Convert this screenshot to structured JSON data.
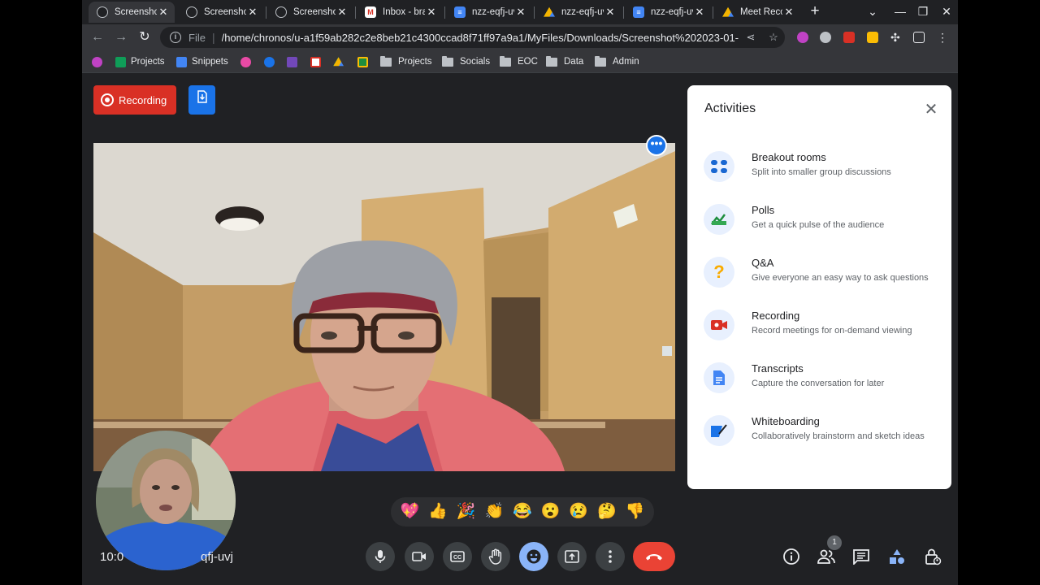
{
  "browser": {
    "tabs": [
      {
        "title": "Screenshot",
        "icon": "globe-icon",
        "active": true
      },
      {
        "title": "Screenshot",
        "icon": "globe-icon"
      },
      {
        "title": "Screenshot",
        "icon": "globe-icon"
      },
      {
        "title": "Inbox - bra",
        "icon": "gmail-icon"
      },
      {
        "title": "nzz-eqfj-uvj",
        "icon": "docs-icon"
      },
      {
        "title": "nzz-eqfj-uvj",
        "icon": "drive-icon"
      },
      {
        "title": "nzz-eqfj-uvj",
        "icon": "docs-icon"
      },
      {
        "title": "Meet Recor",
        "icon": "drive-icon"
      }
    ],
    "new_tab": "+",
    "address": {
      "scheme": "File",
      "url": "/home/chronos/u-a1f59ab282c2e8beb21c4300ccad8f71ff97a9a1/MyFiles/Downloads/Screenshot%202023-01-..."
    },
    "bookmarks": [
      {
        "label": "Projects",
        "icon": "sheets-icon",
        "color": "#0f9d58"
      },
      {
        "label": "Snippets",
        "icon": "docs-icon",
        "color": "#4285f4"
      },
      {
        "label": "",
        "icon": "pink-app-icon",
        "color": "#e84aa5"
      },
      {
        "label": "",
        "icon": "blue-app-icon",
        "color": "#1a73e8"
      },
      {
        "label": "",
        "icon": "forms-icon",
        "color": "#7248b9"
      },
      {
        "label": "",
        "icon": "gmail-icon",
        "color": "#d93025"
      },
      {
        "label": "",
        "icon": "drive-icon",
        "color": "#0f9d58"
      },
      {
        "label": "",
        "icon": "classroom-icon",
        "color": "#1e8e3e"
      },
      {
        "label": "Projects",
        "icon": "folder-icon"
      },
      {
        "label": "Socials",
        "icon": "folder-icon"
      },
      {
        "label": "EOC",
        "icon": "folder-icon"
      },
      {
        "label": "Data",
        "icon": "folder-icon"
      },
      {
        "label": "Admin",
        "icon": "folder-icon"
      }
    ]
  },
  "meet": {
    "recording_label": "Recording",
    "clock": "10:0",
    "meeting_code": "qfj-uvj",
    "reactions": [
      "💖",
      "👍",
      "🎉",
      "👏",
      "😂",
      "😮",
      "😢",
      "🤔",
      "👎"
    ],
    "people_count": "1",
    "colors": {
      "recording": "#d93025",
      "end_call": "#ea4335",
      "accent": "#1a73e8",
      "active_control": "#8ab4f8"
    }
  },
  "activities": {
    "title": "Activities",
    "items": [
      {
        "name": "Breakout rooms",
        "desc": "Split into smaller group discussions",
        "icon": "breakout-rooms-icon"
      },
      {
        "name": "Polls",
        "desc": "Get a quick pulse of the audience",
        "icon": "polls-icon"
      },
      {
        "name": "Q&A",
        "desc": "Give everyone an easy way to ask questions",
        "icon": "qa-icon"
      },
      {
        "name": "Recording",
        "desc": "Record meetings for on-demand viewing",
        "icon": "recording-icon"
      },
      {
        "name": "Transcripts",
        "desc": "Capture the conversation for later",
        "icon": "transcripts-icon"
      },
      {
        "name": "Whiteboarding",
        "desc": "Collaboratively brainstorm and sketch ideas",
        "icon": "whiteboard-icon"
      }
    ]
  }
}
